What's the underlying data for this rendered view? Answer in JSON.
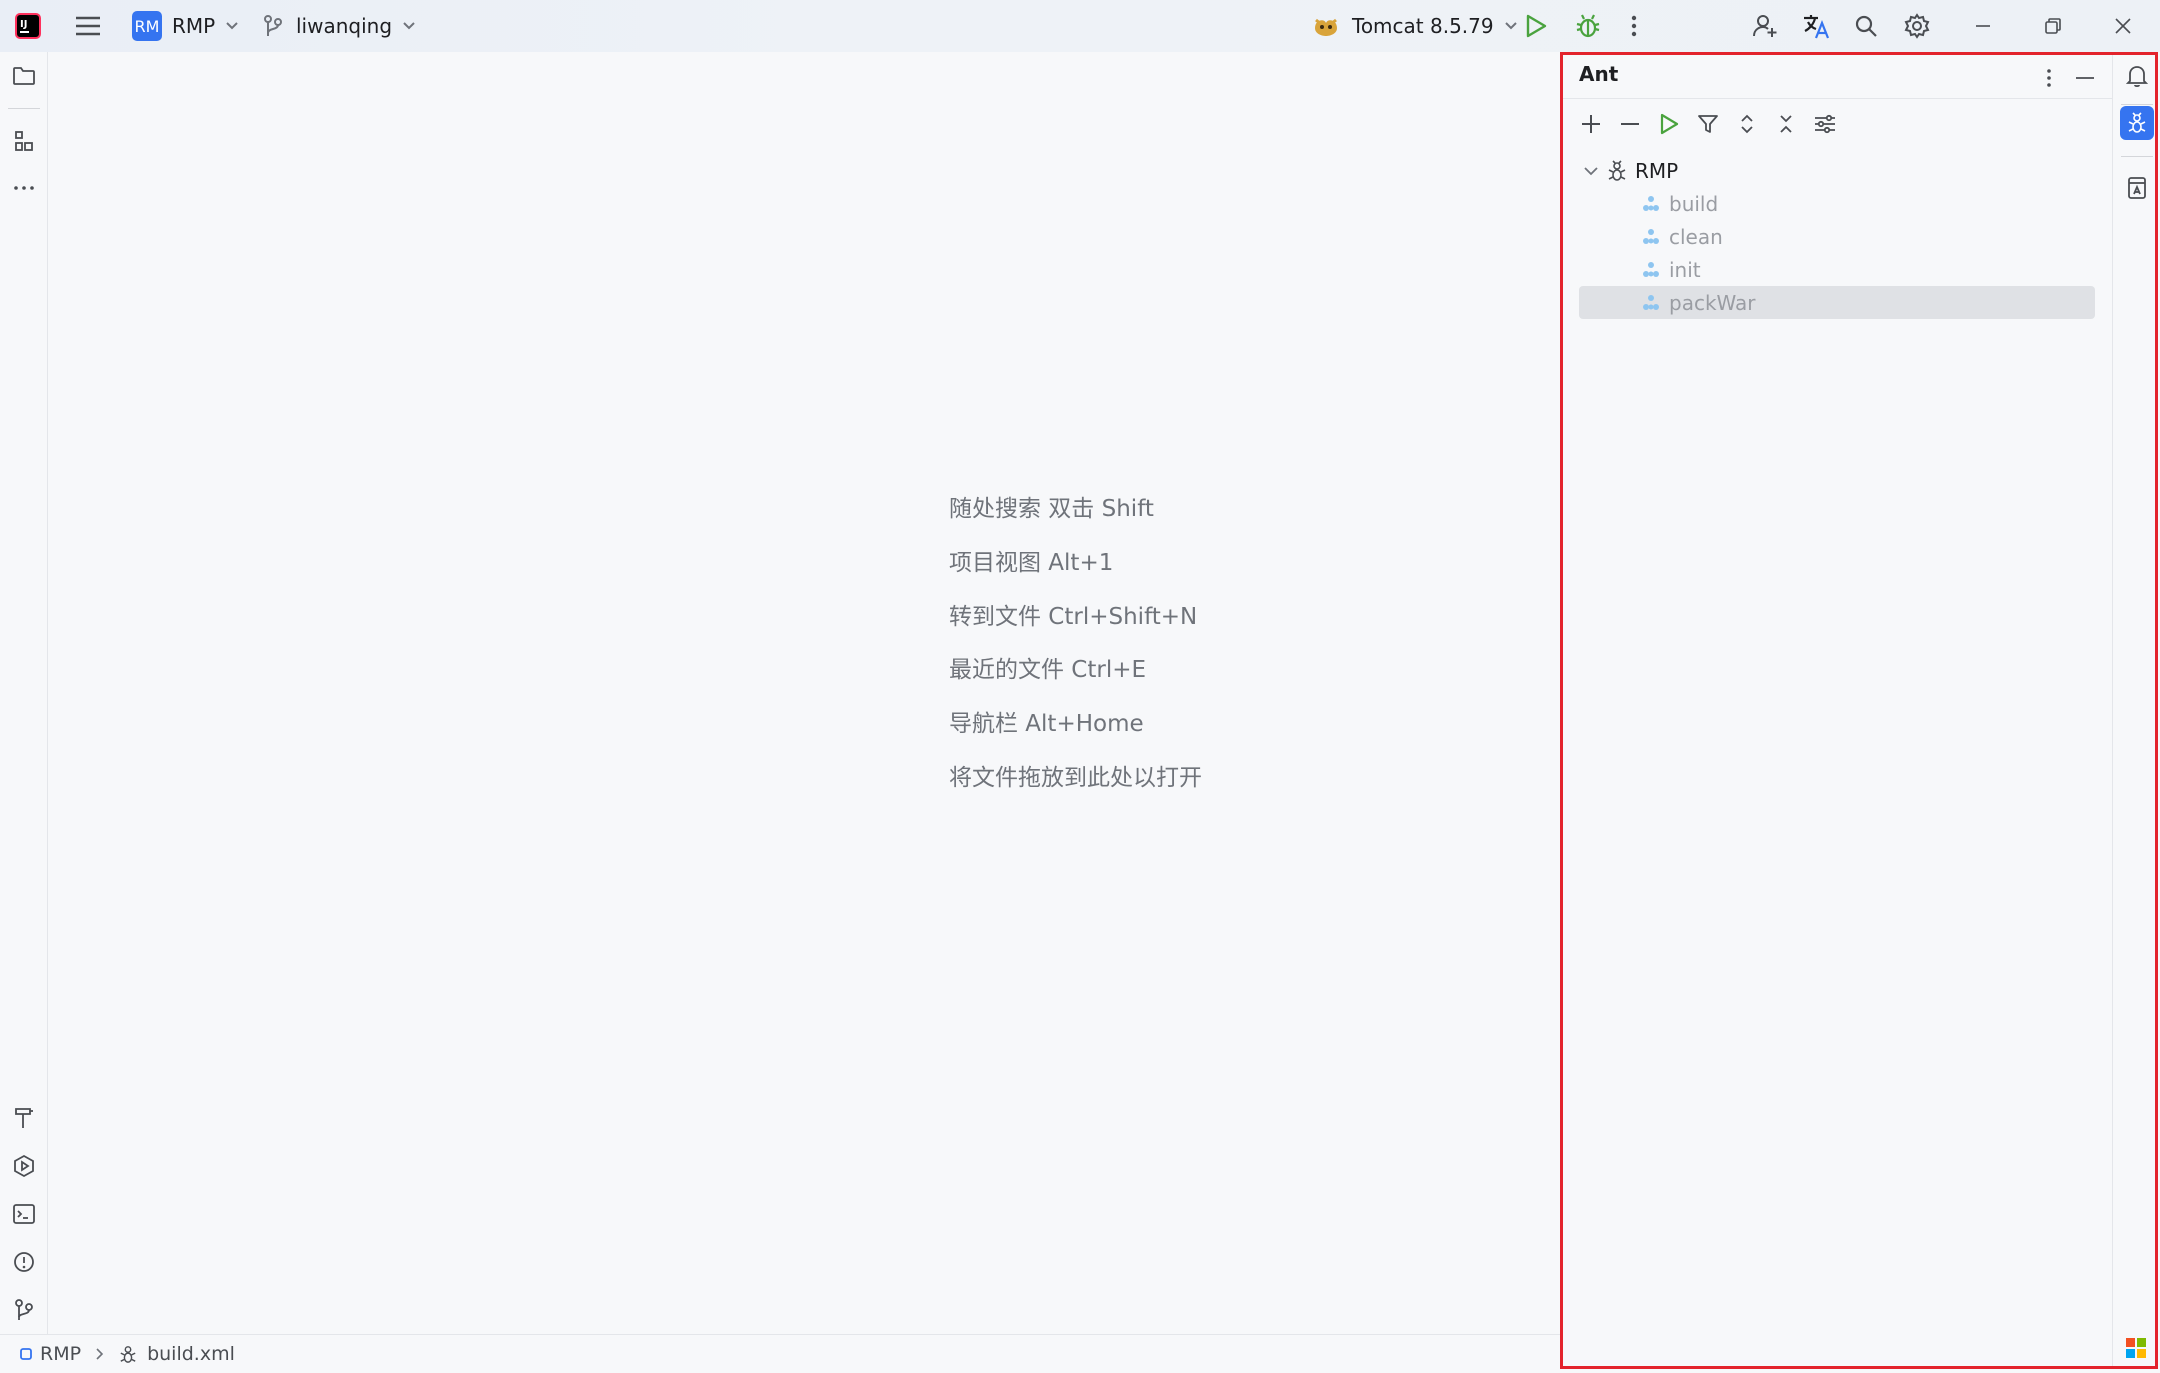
{
  "titlebar": {
    "app_icon": "intellij-logo-icon",
    "menu_icon": "hamburger-menu-icon",
    "project_badge": "RM",
    "project_name": "RMP",
    "branch_icon": "git-branch-icon",
    "branch_name": "liwanqing",
    "run_config_icon": "tomcat-icon",
    "run_config": "Tomcat 8.5.79",
    "run_color": "#4aa33e",
    "debug_color": "#4aa33e"
  },
  "editor": {
    "hints": [
      "随处搜索 双击 Shift",
      "项目视图 Alt+1",
      "转到文件 Ctrl+Shift+N",
      "最近的文件 Ctrl+E",
      "导航栏 Alt+Home",
      "将文件拖放到此处以打开"
    ]
  },
  "ant": {
    "title": "Ant",
    "root": "RMP",
    "targets": [
      "build",
      "clean",
      "init",
      "packWar"
    ],
    "selected": "packWar",
    "target_color": "#8ec5f0",
    "target_text_color": "#9a9da3",
    "highlight_border": "#e3232c"
  },
  "statusbar": {
    "breadcrumb": [
      "RMP",
      "build.xml"
    ]
  },
  "accent": "#3574f0"
}
